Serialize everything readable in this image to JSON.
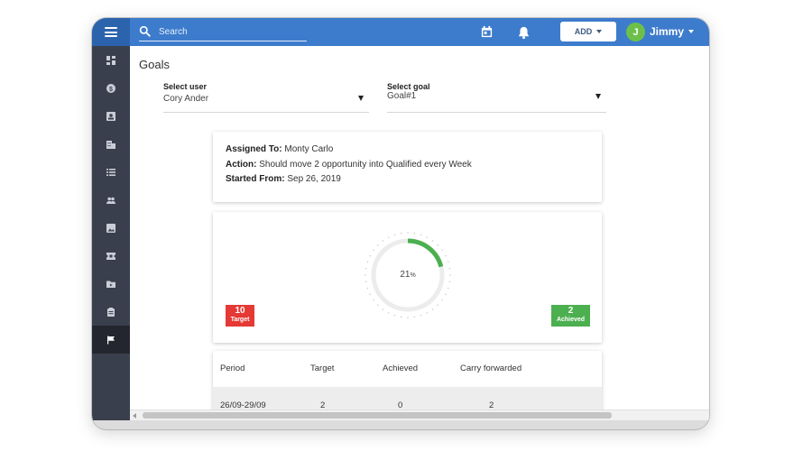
{
  "topbar": {
    "search_placeholder": "Search",
    "add_label": "ADD",
    "user_initial": "J",
    "user_name": "Jimmy",
    "accent_color": "#3d7ccc"
  },
  "sidebar": {
    "items": [
      {
        "icon": "dashboard-icon"
      },
      {
        "icon": "dollar-icon"
      },
      {
        "icon": "contact-card-icon"
      },
      {
        "icon": "building-icon"
      },
      {
        "icon": "list-icon"
      },
      {
        "icon": "people-icon"
      },
      {
        "icon": "image-icon"
      },
      {
        "icon": "ticket-icon"
      },
      {
        "icon": "folder-icon"
      },
      {
        "icon": "clipboard-icon"
      },
      {
        "icon": "flag-icon",
        "active": true
      }
    ]
  },
  "page": {
    "title": "Goals"
  },
  "filters": {
    "user_label": "Select user",
    "user_value": "Cory Ander",
    "goal_label": "Select goal",
    "goal_value": "Goal#1"
  },
  "goal_info": {
    "assigned_label": "Assigned To:",
    "assigned_value": "Monty Carlo",
    "action_label": "Action:",
    "action_value": "Should move 2 opportunity into Qualified every  Week",
    "started_label": "Started From:",
    "started_value": "Sep 26, 2019"
  },
  "progress": {
    "percent": 21,
    "percent_symbol": "%",
    "target_value": "10",
    "target_label": "Target",
    "achieved_value": "2",
    "achieved_label": "Achieved",
    "target_color": "#e53935",
    "achieved_color": "#4caf50"
  },
  "table": {
    "headers": [
      "Period",
      "Target",
      "Achieved",
      "Carry forwarded"
    ],
    "rows": [
      [
        "26/09-29/09",
        "2",
        "0",
        "2"
      ]
    ]
  }
}
